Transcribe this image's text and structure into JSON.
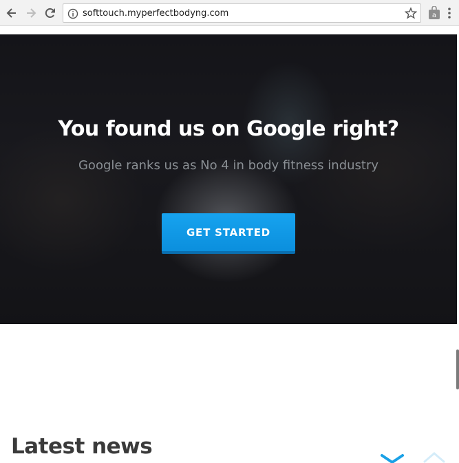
{
  "browser": {
    "url": "softtouch.myperfectbodyng.com"
  },
  "hero": {
    "title": "You found us on Google right?",
    "subtitle": "Google ranks us as No 4 in body fitness industry",
    "cta_label": "GET STARTED"
  },
  "news": {
    "heading": "Latest news"
  },
  "colors": {
    "cta": "#0b95e6",
    "accent": "#1aa1e6"
  },
  "icons": [
    "back-arrow-icon",
    "forward-arrow-icon",
    "reload-icon",
    "info-icon",
    "star-icon",
    "extension-icon",
    "menu-icon",
    "chevron-down-icon",
    "chevron-up-icon"
  ]
}
